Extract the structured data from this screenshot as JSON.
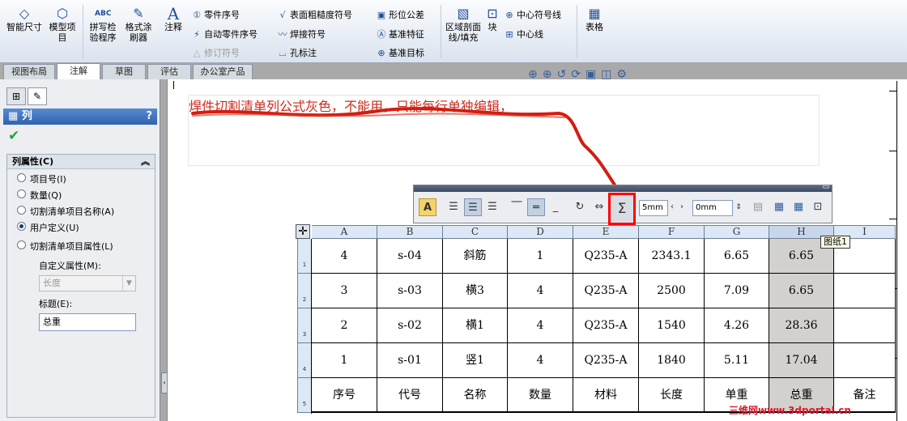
{
  "ribbon": {
    "smart_dim": "智能尺寸",
    "model_items": "模型项目",
    "spell_check": "拼写检验程序",
    "format_painter": "格式涂刷器",
    "note": "注释",
    "balloon": "零件序号",
    "auto_balloon": "自动零件序号",
    "revision_symbol": "修订符号",
    "surface_finish": "表面粗糙度符号",
    "weld_symbol": "焊接符号",
    "hole_callout": "孔标注",
    "gtol": "形位公差",
    "datum_feature": "基准特征",
    "datum_target": "基准目标",
    "area_hatch": "区域剖面线/填充",
    "block": "块",
    "center_mark": "中心符号线",
    "centerline": "中心线",
    "tables": "表格"
  },
  "tabs": [
    {
      "label": "视图布局"
    },
    {
      "label": "注解"
    },
    {
      "label": "草图"
    },
    {
      "label": "评估"
    },
    {
      "label": "办公室产品"
    }
  ],
  "panel": {
    "title": "列",
    "help": "?",
    "group_title": "列属性(C)",
    "options": [
      {
        "label": "项目号(I)",
        "checked": false
      },
      {
        "label": "数量(Q)",
        "checked": false
      },
      {
        "label": "切割清单项目名称(A)",
        "checked": false
      },
      {
        "label": "用户定义(U)",
        "checked": true
      },
      {
        "label": "切割清单项目属性(L)",
        "checked": false
      }
    ],
    "custom_prop_label": "自定义属性(M):",
    "custom_prop_value": "长度",
    "caption_label": "标题(E):",
    "caption_value": "总重"
  },
  "note_text": "焊件切割清单列公式灰色，不能用，只能每行单独编辑，",
  "format_toolbar": {
    "spin1": "5mm",
    "spin2": "0mm"
  },
  "table": {
    "col_letters": [
      "A",
      "B",
      "C",
      "D",
      "E",
      "F",
      "G",
      "H",
      "I"
    ],
    "row_numbers": [
      "1",
      "2",
      "3",
      "4",
      "5"
    ],
    "rows": [
      [
        "4",
        "s-04",
        "斜筋",
        "1",
        "Q235-A",
        "2343.1",
        "6.65",
        "6.65",
        ""
      ],
      [
        "3",
        "s-03",
        "横3",
        "4",
        "Q235-A",
        "2500",
        "7.09",
        "6.65",
        ""
      ],
      [
        "2",
        "s-02",
        "横1",
        "4",
        "Q235-A",
        "1540",
        "4.26",
        "28.36",
        ""
      ],
      [
        "1",
        "s-01",
        "竖1",
        "4",
        "Q235-A",
        "1840",
        "5.11",
        "17.04",
        ""
      ],
      [
        "序号",
        "代号",
        "名称",
        "数量",
        "材料",
        "长度",
        "单重",
        "总重",
        "备注"
      ]
    ],
    "highlight_col": 7
  },
  "tooltip": "图纸1",
  "watermark": "三维网www.3dportal.cn",
  "colors": {
    "annotation_red": "#cc2a1c",
    "sum_highlight": "#ff0000",
    "selected_column": "#d3d1ce"
  }
}
